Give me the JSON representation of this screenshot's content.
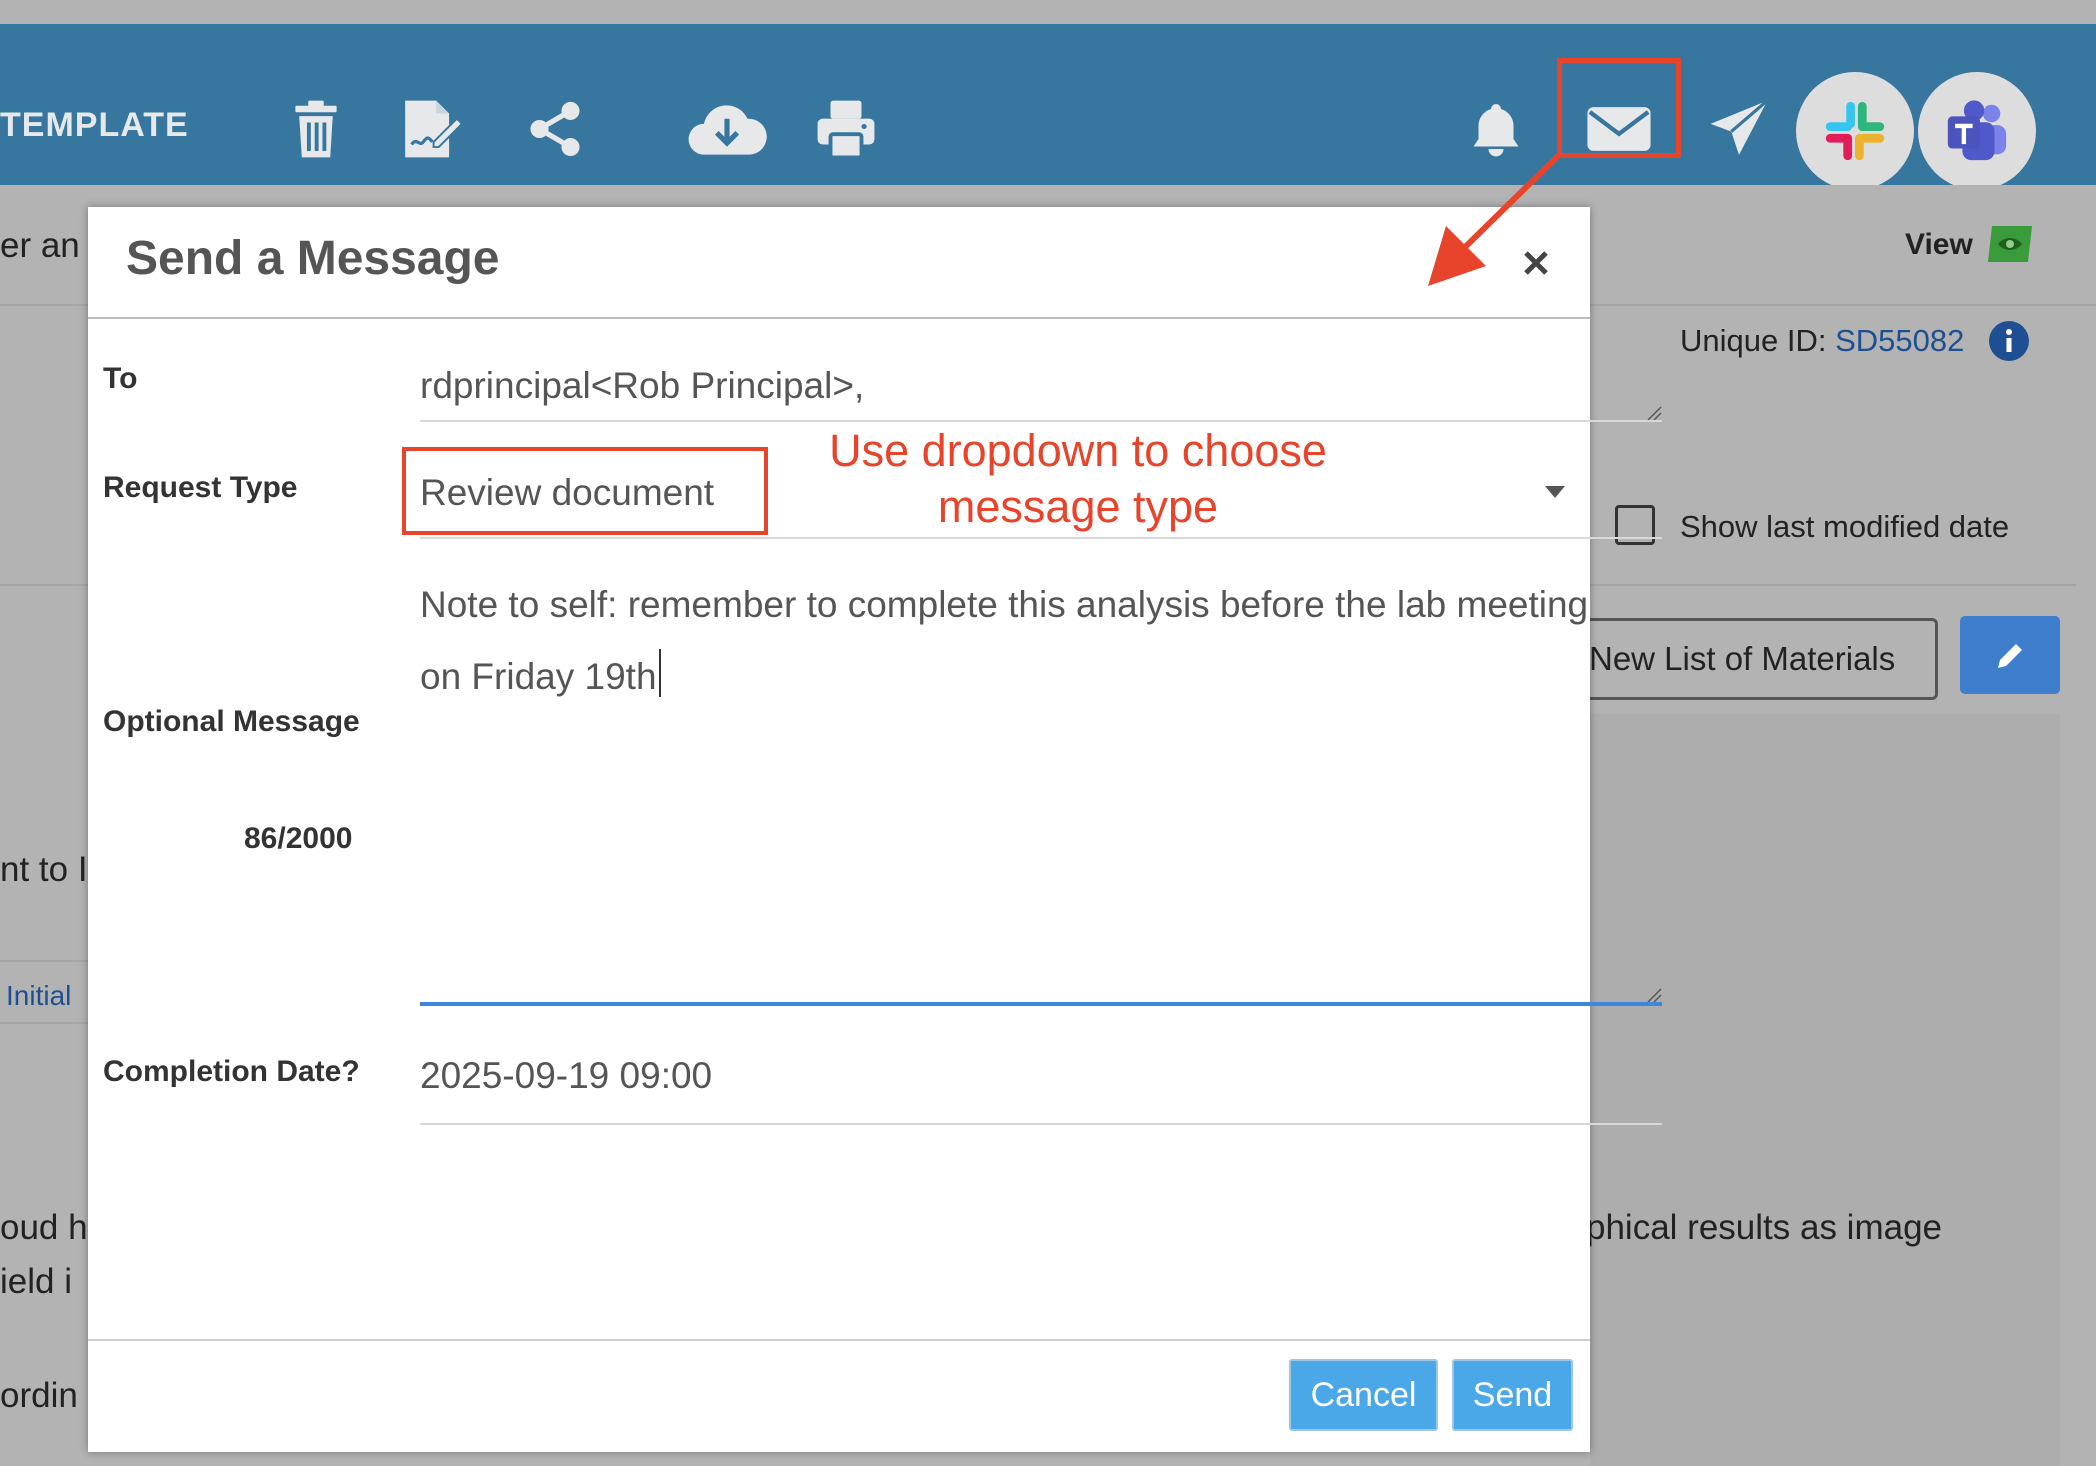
{
  "toolbar": {
    "title": "TEMPLATE",
    "icons": [
      "trash-icon",
      "sign-icon",
      "share-icon",
      "cloud-download-icon",
      "print-icon",
      "bell-icon",
      "envelope-icon",
      "paper-plane-icon",
      "slack-icon",
      "teams-icon"
    ]
  },
  "background": {
    "view_label": "View",
    "unique_id_label": "Unique ID: ",
    "unique_id_value": "SD55082",
    "show_last_modified": "Show last modified date",
    "materials_button": "New List of Materials",
    "fragment_top": "er  an",
    "fragment_mid": "nt to I",
    "fragment_initial": "Initial",
    "fragment_row1": "oud h",
    "fragment_row2": "ield i",
    "fragment_row3": "ordin",
    "fragment_right": "phical results as image"
  },
  "modal": {
    "title": "Send a Message",
    "to_label": "To",
    "to_value": "rdprincipal<Rob Principal>,",
    "request_type_label": "Request Type",
    "request_type_value": "Review document",
    "optional_message_label": "Optional Message",
    "message_counter": "86/2000",
    "message_value": "Note to self: remember to complete this analysis before the lab meeting on Friday 19th",
    "completion_date_label": "Completion Date?",
    "completion_date_value": "2025-09-19 09:00",
    "cancel_label": "Cancel",
    "send_label": "Send"
  },
  "annotation": {
    "text_line1": "Use dropdown to choose",
    "text_line2": "message type"
  },
  "colors": {
    "toolbar": "#36769f",
    "annotation": "#e8442b",
    "button": "#4aa8e8",
    "link": "#1f4f93"
  }
}
